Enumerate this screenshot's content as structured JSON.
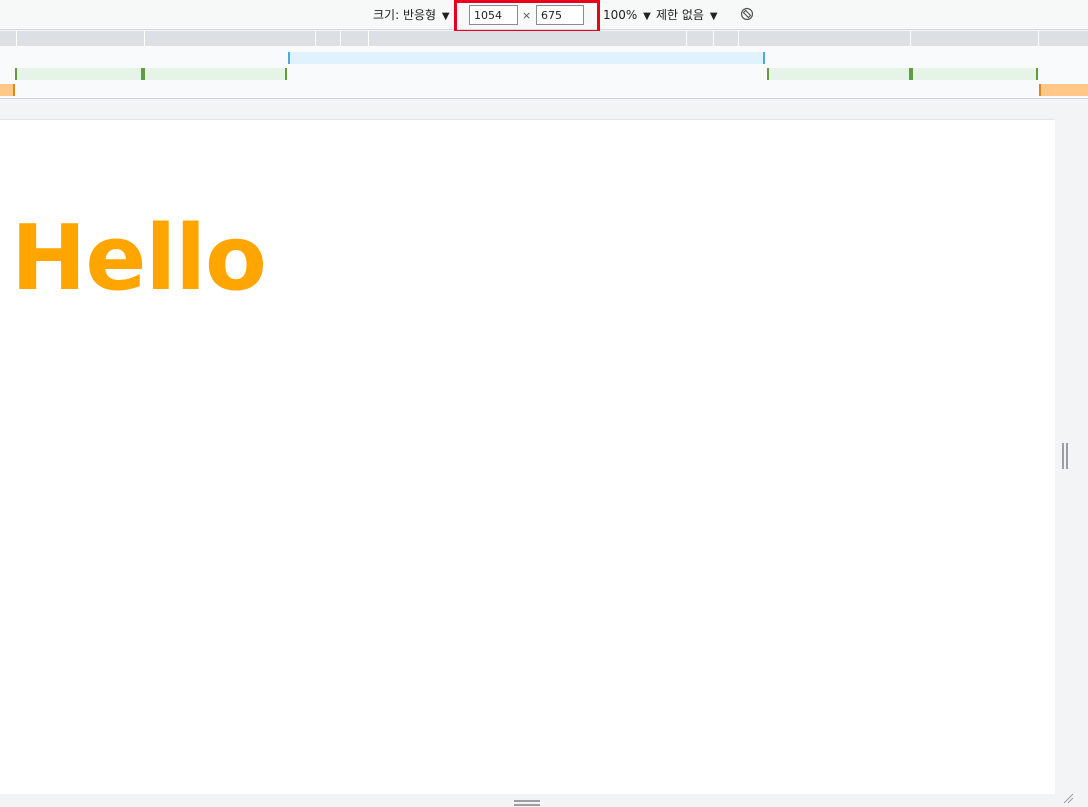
{
  "toolbar": {
    "size_label": "크기: 반응형",
    "width_value": "1054",
    "height_value": "675",
    "times": "×",
    "zoom_label": "100%",
    "throttle_label": "제한 없음",
    "caret": "▼",
    "rotate_icon": "rotate-icon",
    "highlight_color": "#e8001c"
  },
  "media_queries": {
    "colors": {
      "max_width": "#dff2fd",
      "min_max": "#e6f4e8",
      "min_width": "#ffc788"
    }
  },
  "viewport": {
    "heading": "Hello",
    "heading_color": "#ffa500",
    "background": "#ffffff"
  }
}
